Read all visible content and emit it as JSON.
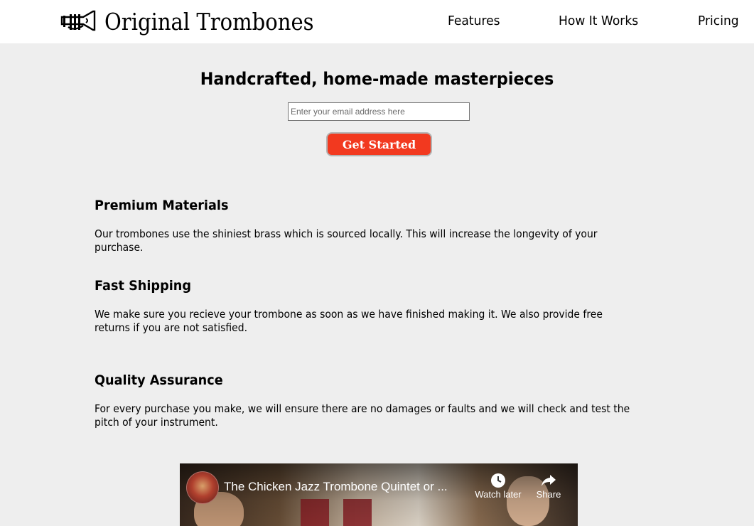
{
  "header": {
    "brand": "Original Trombones",
    "nav": [
      "Features",
      "How It Works",
      "Pricing"
    ]
  },
  "hero": {
    "title": "Handcrafted, home-made masterpieces",
    "email_placeholder": "Enter your email address here",
    "cta_label": "Get Started"
  },
  "features": [
    {
      "title": "Premium Materials",
      "text": "Our trombones use the shiniest brass which is sourced locally. This will increase the longevity of your purchase."
    },
    {
      "title": "Fast Shipping",
      "text": "We make sure you recieve your trombone as soon as we have finished making it. We also provide free returns if you are not satisfied."
    },
    {
      "title": "Quality Assurance",
      "text": "For every purchase you make, we will ensure there are no damages or faults and we will check and test the pitch of your instrument."
    }
  ],
  "video": {
    "title": "The Chicken Jazz Trombone Quintet or ...",
    "watch_later": "Watch later",
    "share": "Share"
  },
  "colors": {
    "background": "#eeeeee",
    "header": "#ffffff",
    "cta": "#f2391f"
  },
  "icons": [
    "trumpet-logo-icon",
    "clock-icon",
    "share-arrow-icon"
  ]
}
